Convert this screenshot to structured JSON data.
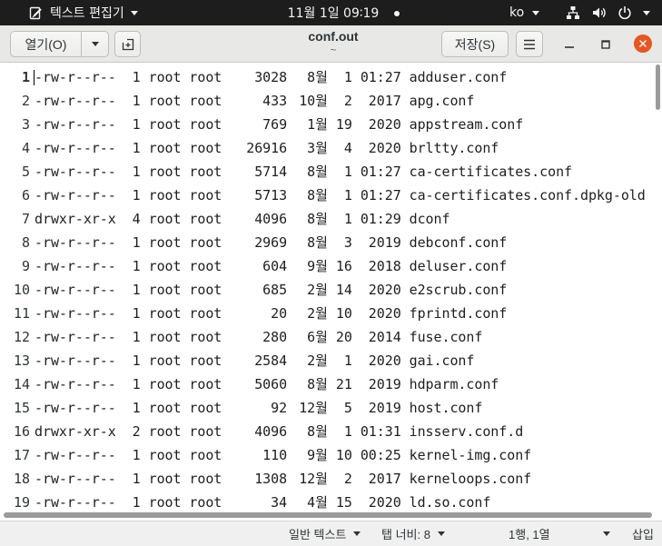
{
  "top_bar": {
    "app_name": "텍스트 편집기",
    "clock": "11월 1일 09∶19",
    "input_source": "ko",
    "icons": {
      "app": "text-editor-icon",
      "notification": "notification-dot-icon",
      "network": "network-wired-icon",
      "volume": "volume-icon",
      "power": "power-icon",
      "dropdown": "pan-down-icon"
    }
  },
  "header_bar": {
    "open_label": "열기(O)",
    "title": "conf.out",
    "subtitle": "~",
    "save_label": "저장(S)",
    "icons": {
      "open_dropdown": "pan-down-icon",
      "new_tab": "new-tab-icon",
      "menu": "hamburger-menu-icon",
      "minimize": "minimize-icon",
      "maximize": "maximize-icon",
      "close": "close-icon"
    }
  },
  "editor": {
    "current_line": 1,
    "lines": [
      {
        "n": "1",
        "perms": "-rw-r--r--",
        "links": "1",
        "owner": "root",
        "group": "root",
        "size": "3028",
        "month": "8월",
        "day": "1",
        "time": "01:27",
        "name": "adduser.conf"
      },
      {
        "n": "2",
        "perms": "-rw-r--r--",
        "links": "1",
        "owner": "root",
        "group": "root",
        "size": "433",
        "month": "10월",
        "day": "2",
        "time": "2017",
        "name": "apg.conf"
      },
      {
        "n": "3",
        "perms": "-rw-r--r--",
        "links": "1",
        "owner": "root",
        "group": "root",
        "size": "769",
        "month": "1월",
        "day": "19",
        "time": "2020",
        "name": "appstream.conf"
      },
      {
        "n": "4",
        "perms": "-rw-r--r--",
        "links": "1",
        "owner": "root",
        "group": "root",
        "size": "26916",
        "month": "3월",
        "day": "4",
        "time": "2020",
        "name": "brltty.conf"
      },
      {
        "n": "5",
        "perms": "-rw-r--r--",
        "links": "1",
        "owner": "root",
        "group": "root",
        "size": "5714",
        "month": "8월",
        "day": "1",
        "time": "01:27",
        "name": "ca-certificates.conf"
      },
      {
        "n": "6",
        "perms": "-rw-r--r--",
        "links": "1",
        "owner": "root",
        "group": "root",
        "size": "5713",
        "month": "8월",
        "day": "1",
        "time": "01:27",
        "name": "ca-certificates.conf.dpkg-old"
      },
      {
        "n": "7",
        "perms": "drwxr-xr-x",
        "links": "4",
        "owner": "root",
        "group": "root",
        "size": "4096",
        "month": "8월",
        "day": "1",
        "time": "01:29",
        "name": "dconf"
      },
      {
        "n": "8",
        "perms": "-rw-r--r--",
        "links": "1",
        "owner": "root",
        "group": "root",
        "size": "2969",
        "month": "8월",
        "day": "3",
        "time": "2019",
        "name": "debconf.conf"
      },
      {
        "n": "9",
        "perms": "-rw-r--r--",
        "links": "1",
        "owner": "root",
        "group": "root",
        "size": "604",
        "month": "9월",
        "day": "16",
        "time": "2018",
        "name": "deluser.conf"
      },
      {
        "n": "10",
        "perms": "-rw-r--r--",
        "links": "1",
        "owner": "root",
        "group": "root",
        "size": "685",
        "month": "2월",
        "day": "14",
        "time": "2020",
        "name": "e2scrub.conf"
      },
      {
        "n": "11",
        "perms": "-rw-r--r--",
        "links": "1",
        "owner": "root",
        "group": "root",
        "size": "20",
        "month": "2월",
        "day": "10",
        "time": "2020",
        "name": "fprintd.conf"
      },
      {
        "n": "12",
        "perms": "-rw-r--r--",
        "links": "1",
        "owner": "root",
        "group": "root",
        "size": "280",
        "month": "6월",
        "day": "20",
        "time": "2014",
        "name": "fuse.conf"
      },
      {
        "n": "13",
        "perms": "-rw-r--r--",
        "links": "1",
        "owner": "root",
        "group": "root",
        "size": "2584",
        "month": "2월",
        "day": "1",
        "time": "2020",
        "name": "gai.conf"
      },
      {
        "n": "14",
        "perms": "-rw-r--r--",
        "links": "1",
        "owner": "root",
        "group": "root",
        "size": "5060",
        "month": "8월",
        "day": "21",
        "time": "2019",
        "name": "hdparm.conf"
      },
      {
        "n": "15",
        "perms": "-rw-r--r--",
        "links": "1",
        "owner": "root",
        "group": "root",
        "size": "92",
        "month": "12월",
        "day": "5",
        "time": "2019",
        "name": "host.conf"
      },
      {
        "n": "16",
        "perms": "drwxr-xr-x",
        "links": "2",
        "owner": "root",
        "group": "root",
        "size": "4096",
        "month": "8월",
        "day": "1",
        "time": "01:31",
        "name": "insserv.conf.d"
      },
      {
        "n": "17",
        "perms": "-rw-r--r--",
        "links": "1",
        "owner": "root",
        "group": "root",
        "size": "110",
        "month": "9월",
        "day": "10",
        "time": "00:25",
        "name": "kernel-img.conf"
      },
      {
        "n": "18",
        "perms": "-rw-r--r--",
        "links": "1",
        "owner": "root",
        "group": "root",
        "size": "1308",
        "month": "12월",
        "day": "2",
        "time": "2017",
        "name": "kerneloops.conf"
      },
      {
        "n": "19",
        "perms": "-rw-r--r--",
        "links": "1",
        "owner": "root",
        "group": "root",
        "size": "34",
        "month": "4월",
        "day": "15",
        "time": "2020",
        "name": "ld.so.conf"
      }
    ]
  },
  "status_bar": {
    "language": "일반 텍스트",
    "tab_width": "탭 너비: 8",
    "cursor_position": "1행, 1열",
    "mode": "삽입"
  },
  "colors": {
    "top_bar": "#1d1d1d",
    "header_bar": "#e8e8e7",
    "close_button": "#e95420",
    "editor_background": "#ffffff",
    "editor_text": "#1e1e1e",
    "status_bar": "#f0f0f0"
  }
}
